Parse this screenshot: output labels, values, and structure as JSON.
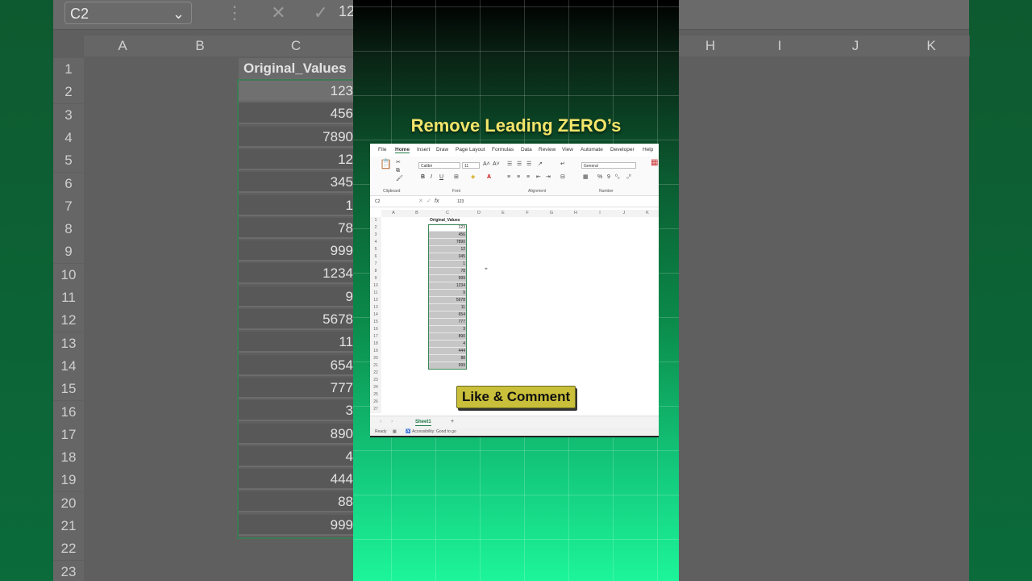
{
  "background": {
    "name_box": "C2",
    "formula_value": "12",
    "fx_symbol": "fx",
    "columns": [
      "A",
      "B",
      "C",
      "",
      "",
      "",
      "",
      "H",
      "I",
      "J",
      "K"
    ],
    "rows": [
      "1",
      "2",
      "3",
      "4",
      "5",
      "6",
      "7",
      "8",
      "9",
      "10",
      "11",
      "12",
      "13",
      "14",
      "15",
      "16",
      "17",
      "18",
      "19",
      "20",
      "21",
      "22",
      "23"
    ],
    "header": "Original_Values",
    "values": [
      "123",
      "456",
      "7890",
      "12",
      "345",
      "1",
      "78",
      "999",
      "1234",
      "9",
      "5678",
      "11",
      "654",
      "777",
      "3",
      "890",
      "4",
      "444",
      "88",
      "999"
    ]
  },
  "headline": "Remove Leading ZERO’s",
  "excel": {
    "menu": [
      "File",
      "Home",
      "Insert",
      "Draw",
      "Page Layout",
      "Formulas",
      "Data",
      "Review",
      "View",
      "Automate",
      "Developer",
      "Help"
    ],
    "active_tab": "Home",
    "font_name": "Calibri",
    "font_size": "11",
    "number_format": "General",
    "groups": [
      "Clipboard",
      "Font",
      "Alignment",
      "Number"
    ],
    "paste_label": "Paste",
    "cond_format_label": "Conditi\nFormatti",
    "name_box": "C2",
    "formula_value": "123",
    "fx_symbol": "fx",
    "columns": [
      "A",
      "B",
      "C",
      "D",
      "E",
      "F",
      "G",
      "H",
      "I",
      "J",
      "K"
    ],
    "rows": [
      "1",
      "2",
      "3",
      "4",
      "5",
      "6",
      "7",
      "8",
      "9",
      "10",
      "11",
      "12",
      "13",
      "14",
      "15",
      "16",
      "17",
      "18",
      "19",
      "20",
      "21",
      "22",
      "23",
      "24",
      "25",
      "26",
      "27"
    ],
    "header": "Original_Values",
    "values": [
      "123",
      "456",
      "7890",
      "12",
      "345",
      "1",
      "78",
      "999",
      "1234",
      "9",
      "5678",
      "11",
      "654",
      "777",
      "3",
      "890",
      "4",
      "444",
      "88",
      "999"
    ],
    "sheet_tab": "Sheet1",
    "status_ready": "Ready",
    "status_accessibility": "Accessibility: Good to go"
  },
  "cta": "Like & Comment",
  "colors": {
    "accent_green": "#1e7a45",
    "headline_yellow": "#f2e56a",
    "cta_yellow": "#c9bf3a"
  }
}
